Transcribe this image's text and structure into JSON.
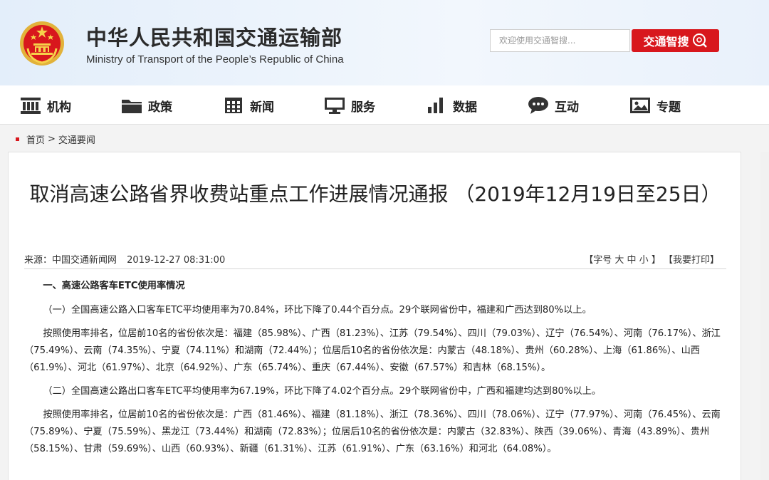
{
  "header": {
    "title": "中华人民共和国交通运输部",
    "subtitle": "Ministry of Transport of the People’s Republic of China",
    "search_placeholder": "欢迎使用交通智搜...",
    "search_button": "交通智搜"
  },
  "nav": {
    "items": [
      {
        "label": "机构",
        "icon": "institution-icon"
      },
      {
        "label": "政策",
        "icon": "folder-icon"
      },
      {
        "label": "新闻",
        "icon": "news-grid-icon"
      },
      {
        "label": "服务",
        "icon": "monitor-icon"
      },
      {
        "label": "数据",
        "icon": "bar-chart-icon"
      },
      {
        "label": "互动",
        "icon": "chat-bubble-icon"
      },
      {
        "label": "专题",
        "icon": "image-icon"
      }
    ]
  },
  "breadcrumb": {
    "home": "首页",
    "separator": ">",
    "current": "交通要闻"
  },
  "article": {
    "title": "取消高速公路省界收费站重点工作进展情况通报 （2019年12月19日至25日）",
    "source": "来源：中国交通新闻网",
    "date": "2019-12-27 08:31:00",
    "font_size_label": "【字号",
    "font_large": "大",
    "font_medium": "中",
    "font_small": "小",
    "font_size_close": "】",
    "print_label": "【我要打印】",
    "paragraphs": [
      "一、高速公路客车ETC使用率情况",
      "（一）全国高速公路入口客车ETC平均使用率为70.84%，环比下降了0.44个百分点。29个联网省份中，福建和广西达到80%以上。",
      "按照使用率排名，位居前10名的省份依次是：福建（85.98%）、广西（81.23%）、江苏（79.54%）、四川（79.03%）、辽宁（76.54%）、河南（76.17%）、浙江（75.49%）、云南（74.35%）、宁夏（74.11%）和湖南（72.44%）；位居后10名的省份依次是：内蒙古（48.18%）、贵州（60.28%）、上海（61.86%）、山西（61.9%）、河北（61.97%）、北京（64.92%）、广东（65.74%）、重庆（67.44%）、安徽（67.57%）和吉林（68.15%）。",
      "（二）全国高速公路出口客车ETC平均使用率为67.19%，环比下降了4.02个百分点。29个联网省份中，广西和福建均达到80%以上。",
      "按照使用率排名，位居前10名的省份依次是：广西（81.46%）、福建（81.18%）、浙江（78.36%）、四川（78.06%）、辽宁（77.97%）、河南（76.45%）、云南（75.89%）、宁夏（75.59%）、黑龙江（73.44%）和湖南（72.83%）；位居后10名的省份依次是：内蒙古（32.83%）、陕西（39.06%）、青海（43.89%）、贵州（58.15%）、甘肃（59.69%）、山西（60.93%）、新疆（61.31%）、江苏（61.91%）、广东（63.16%）和河北（64.08%）。"
    ]
  },
  "colors": {
    "accent_red": "#d8171d",
    "header_bg": "#e3eefa"
  }
}
